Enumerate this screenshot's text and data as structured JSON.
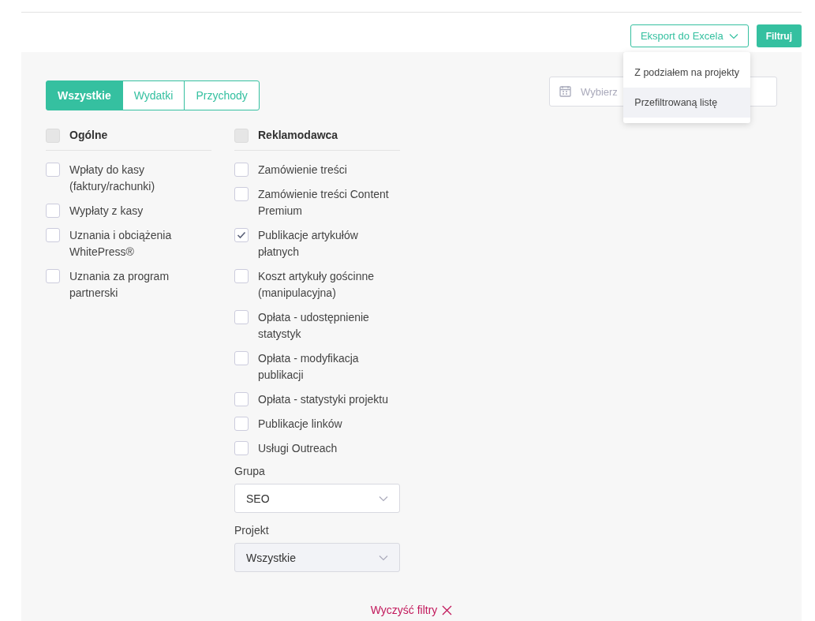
{
  "toolbar": {
    "export_button": "Eksport do Excela",
    "filter_button": "Filtruj"
  },
  "export_menu": [
    {
      "label": "Z podziałem na projekty",
      "highlighted": false
    },
    {
      "label": "Przefiltrowaną listę",
      "highlighted": true
    }
  ],
  "tabs": [
    {
      "label": "Wszystkie",
      "selected": true
    },
    {
      "label": "Wydatki",
      "selected": false
    },
    {
      "label": "Przychody",
      "selected": false
    }
  ],
  "date_field": {
    "placeholder": "Wybierz"
  },
  "groups": [
    {
      "title": "Ogólne",
      "checked": false,
      "items": [
        {
          "label": "Wpłaty do kasy (faktury/rachunki)",
          "checked": false
        },
        {
          "label": "Wypłaty z kasy",
          "checked": false
        },
        {
          "label": "Uznania i obciążenia WhitePress®",
          "checked": false
        },
        {
          "label": "Uznania za program partnerski",
          "checked": false
        }
      ]
    },
    {
      "title": "Reklamodawca",
      "checked": false,
      "items": [
        {
          "label": "Zamówienie treści",
          "checked": false
        },
        {
          "label": "Zamówienie treści Content Premium",
          "checked": false
        },
        {
          "label": "Publikacje artykułów płatnych",
          "checked": true
        },
        {
          "label": "Koszt artykuły gościnne (manipulacyjna)",
          "checked": false
        },
        {
          "label": "Opłata - udostępnienie statystyk",
          "checked": false
        },
        {
          "label": "Opłata - modyfikacja publikacji",
          "checked": false
        },
        {
          "label": "Opłata - statystyki projektu",
          "checked": false
        },
        {
          "label": "Publikacje linków",
          "checked": false
        },
        {
          "label": "Usługi Outreach",
          "checked": false
        }
      ],
      "selects": [
        {
          "label": "Grupa",
          "value": "SEO",
          "disabled": false
        },
        {
          "label": "Projekt",
          "value": "Wszystkie",
          "disabled": true
        }
      ]
    }
  ],
  "clear_filters": "Wyczyść filtry"
}
